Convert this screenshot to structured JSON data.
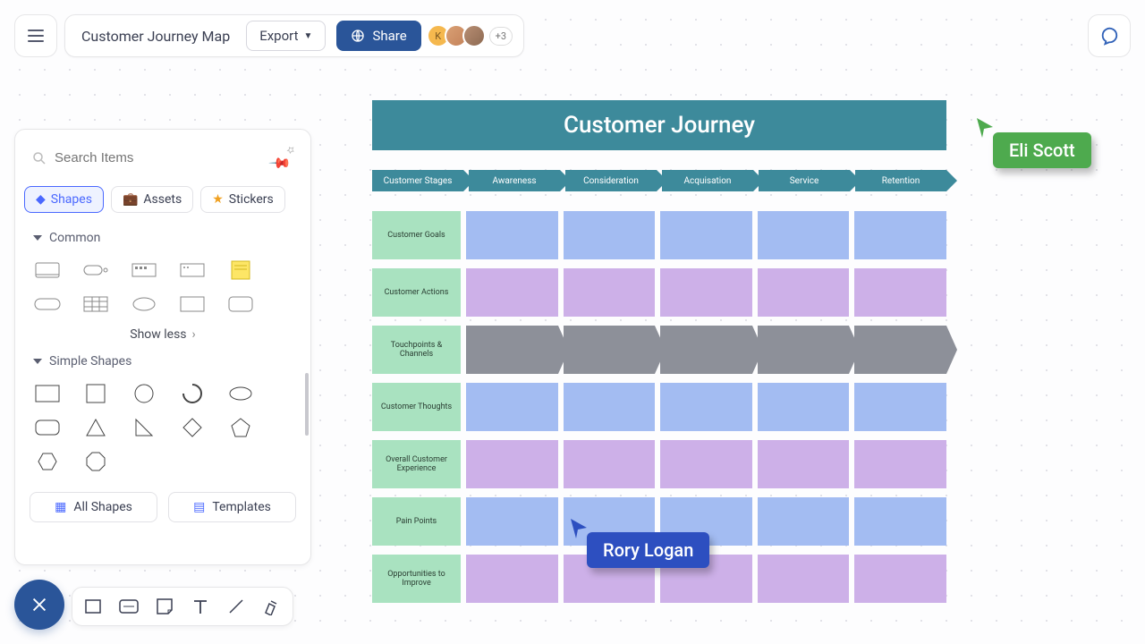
{
  "topbar": {
    "doc_title": "Customer Journey Map",
    "export_label": "Export",
    "share_label": "Share",
    "avatar_letter": "K",
    "more_count": "+3"
  },
  "sidebar": {
    "search_placeholder": "Search Items",
    "tabs": {
      "shapes": "Shapes",
      "assets": "Assets",
      "stickers": "Stickers"
    },
    "common_label": "Common",
    "show_less": "Show less",
    "simple_shapes_label": "Simple Shapes",
    "all_shapes": "All Shapes",
    "templates": "Templates"
  },
  "journey": {
    "title": "Customer Journey",
    "stages": [
      "Customer Stages",
      "Awareness",
      "Consideration",
      "Acquisation",
      "Service",
      "Retention"
    ],
    "rows": [
      "Customer Goals",
      "Customer Actions",
      "Touchpoints & Channels",
      "Customer Thoughts",
      "Overall Customer Experience",
      "Pain Points",
      "Opportunities to Improve"
    ]
  },
  "collaborators": {
    "eli": "Eli Scott",
    "rory": "Rory Logan"
  }
}
